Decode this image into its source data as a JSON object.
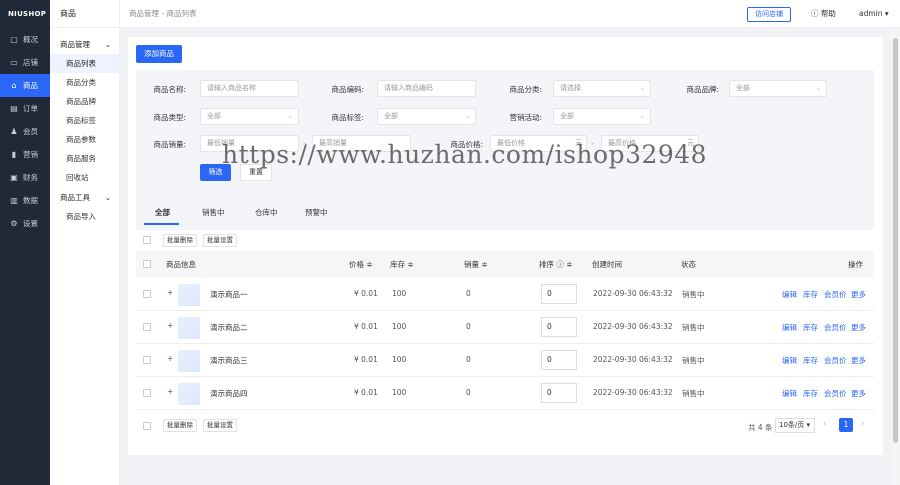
{
  "sidebar": {
    "logo": "NIUSHOP",
    "items": [
      {
        "label": "概况",
        "icon": "overview-icon",
        "glyph": "▢"
      },
      {
        "label": "店铺",
        "icon": "store-icon",
        "glyph": "▭"
      },
      {
        "label": "商品",
        "icon": "goods-icon",
        "glyph": "⌂"
      },
      {
        "label": "订单",
        "icon": "order-icon",
        "glyph": "▤"
      },
      {
        "label": "会员",
        "icon": "member-icon",
        "glyph": "♟"
      },
      {
        "label": "营销",
        "icon": "marketing-icon",
        "glyph": "▮"
      },
      {
        "label": "财务",
        "icon": "finance-icon",
        "glyph": "▣"
      },
      {
        "label": "数据",
        "icon": "data-icon",
        "glyph": "▥"
      },
      {
        "label": "设置",
        "icon": "settings-icon",
        "glyph": "⚙"
      }
    ]
  },
  "subnav": {
    "title": "商品",
    "group1": "商品管理",
    "group1_items": [
      "商品列表",
      "商品分类",
      "商品品牌",
      "商品标签",
      "商品参数",
      "商品服务",
      "回收站"
    ],
    "group2": "商品工具",
    "group2_items": [
      "商品导入"
    ]
  },
  "topbar": {
    "breadcrumb": "商品管理  -  商品列表",
    "visit_store": "访问店铺",
    "help": "帮助",
    "user": "admin ▾"
  },
  "add_button": "添加商品",
  "filters": {
    "name_label": "商品名称:",
    "name_placeholder": "请输入商品名称",
    "code_label": "商品编码:",
    "code_placeholder": "请输入商品编码",
    "category_label": "商品分类:",
    "category_value": "请选择",
    "brand_label": "商品品牌:",
    "brand_value": "全部",
    "type_label": "商品类型:",
    "type_value": "全部",
    "tag_label": "商品标签:",
    "tag_value": "全部",
    "activity_label": "营销活动:",
    "activity_value": "全部",
    "sales_label": "商品销量:",
    "sales_min": "最低销量",
    "sales_max": "最高销量",
    "price_label": "商品价格:",
    "price_min": "最低价格",
    "price_max": "最高价格",
    "yuan": "元",
    "dash": "-",
    "filter_button": "筛选",
    "reset_button": "重置"
  },
  "tabs": [
    "全部",
    "销售中",
    "仓库中",
    "预警中"
  ],
  "batch": {
    "delete": "批量删除",
    "set": "批量设置"
  },
  "table": {
    "headers": {
      "info": "商品信息",
      "price": "价格 ≑",
      "stock": "库存 ≑",
      "sales": "销量 ≑",
      "sort": "排序 ⓘ ≑",
      "created": "创建时间",
      "status": "状态",
      "ops": "操作"
    },
    "rows": [
      {
        "expand": "+",
        "name": "演示商品一",
        "price": "¥ 0.01",
        "stock": "100",
        "sales": "0",
        "sort": "0",
        "created": "2022-09-30 06:43:32",
        "status": "销售中"
      },
      {
        "expand": "+",
        "name": "演示商品二",
        "price": "¥ 0.01",
        "stock": "100",
        "sales": "0",
        "sort": "0",
        "created": "2022-09-30 06:43:32",
        "status": "销售中"
      },
      {
        "expand": "+",
        "name": "演示商品三",
        "price": "¥ 0.01",
        "stock": "100",
        "sales": "0",
        "sort": "0",
        "created": "2022-09-30 06:43:32",
        "status": "销售中"
      },
      {
        "expand": "+",
        "name": "演示商品四",
        "price": "¥ 0.01",
        "stock": "100",
        "sales": "0",
        "sort": "0",
        "created": "2022-09-30 06:43:32",
        "status": "销售中"
      }
    ],
    "actions": [
      "编辑",
      "库存",
      "会员价",
      "更多"
    ]
  },
  "pagination": {
    "total": "共 4 条",
    "page_size": "10条/页 ▾",
    "prev": "‹",
    "page": "1",
    "next": "›"
  },
  "watermark": "https://www.huzhan.com/ishop32948",
  "colors": {
    "primary": "#2b67f6",
    "sidebar": "#1f2937"
  }
}
